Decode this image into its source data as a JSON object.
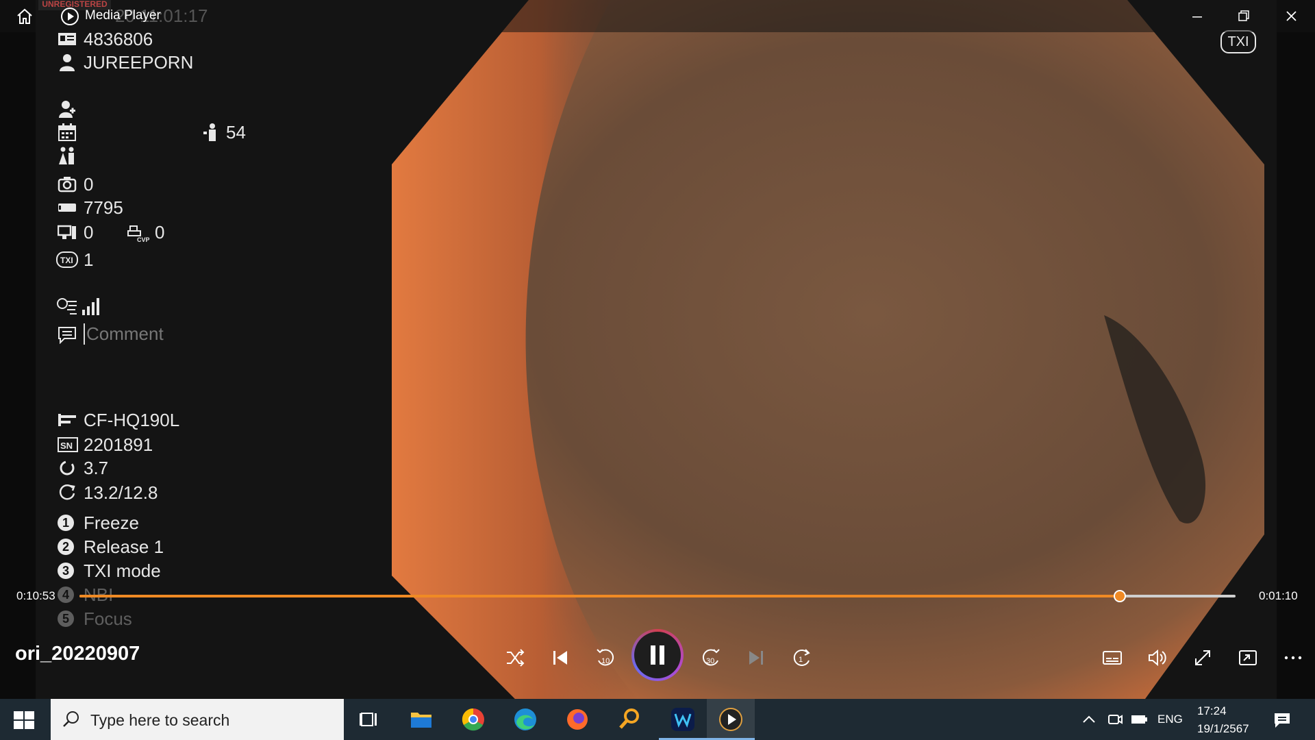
{
  "window": {
    "title": "Media Player",
    "watermark": "UNREGISTERED",
    "ghost_time": "20 11:01:17"
  },
  "overlay": {
    "patient_id": "4836806",
    "patient_name": "JUREEPORN",
    "age": "54",
    "capture_count": "0",
    "counter": "7795",
    "display_count": "0",
    "cvp_count": "0",
    "txi_value": "1",
    "comment_placeholder": "Comment",
    "scope_model": "CF-HQ190L",
    "serial_number": "2201891",
    "value_a": "3.7",
    "value_b": "13.2/12.8",
    "buttons": [
      {
        "num": "1",
        "label": "Freeze"
      },
      {
        "num": "2",
        "label": "Release 1"
      },
      {
        "num": "3",
        "label": "TXI mode"
      },
      {
        "num": "4",
        "label": "NBI"
      },
      {
        "num": "5",
        "label": "Focus"
      }
    ],
    "txi_badge": "TXI"
  },
  "player": {
    "elapsed": "0:10:53",
    "remaining": "0:01:10",
    "progress": 0.9,
    "file_title": "ori_20220907"
  },
  "taskbar": {
    "search_placeholder": "Type here to search",
    "language": "ENG",
    "time": "17:24",
    "date": "19/1/2567"
  },
  "colors": {
    "accent": "#f08a24",
    "taskbar": "#1e2a33"
  }
}
